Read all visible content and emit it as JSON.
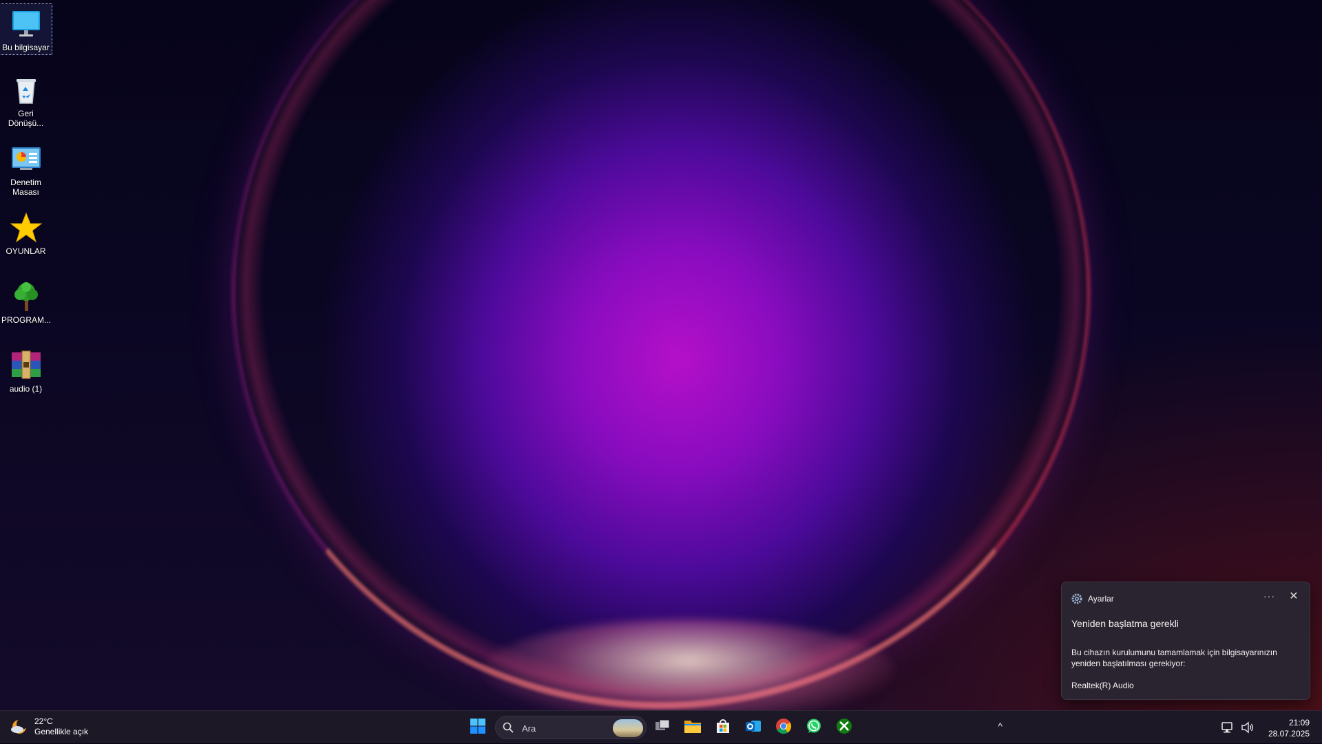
{
  "desktop": {
    "icons": [
      {
        "label": "Bu bilgisayar",
        "icon": "monitor-icon"
      },
      {
        "label": "Geri Dönüşü...",
        "icon": "recycle-bin-icon"
      },
      {
        "label": "Denetim Masası",
        "icon": "control-panel-icon"
      },
      {
        "label": "OYUNLAR",
        "icon": "star-icon"
      },
      {
        "label": "PROGRAM...",
        "icon": "tree-icon"
      },
      {
        "label": "audio (1)",
        "icon": "winrar-archive-icon"
      }
    ]
  },
  "notification": {
    "app": "Ayarlar",
    "more_label": "···",
    "close_label": "✕",
    "title": "Yeniden başlatma gerekli",
    "body": "Bu cihazın kurulumunu tamamlamak için bilgisayarınızın yeniden başlatılması gerekiyor:",
    "device": "Realtek(R) Audio"
  },
  "taskbar": {
    "weather": {
      "temp": "22°C",
      "condition": "Genellikle açık",
      "icon": "moon-cloud-icon"
    },
    "search": {
      "placeholder": "Ara"
    },
    "apps": [
      "start-icon",
      "task-view-icon",
      "file-explorer-icon",
      "microsoft-store-icon",
      "outlook-icon",
      "chrome-icon",
      "whatsapp-icon",
      "xbox-icon"
    ],
    "tray": {
      "chevron": "^",
      "time": "21:09",
      "date": "28.07.2025"
    }
  },
  "colors": {
    "accent_blue": "#1e90ff",
    "toast_bg": "#2a2430",
    "taskbar_bg": "#1c1826"
  }
}
